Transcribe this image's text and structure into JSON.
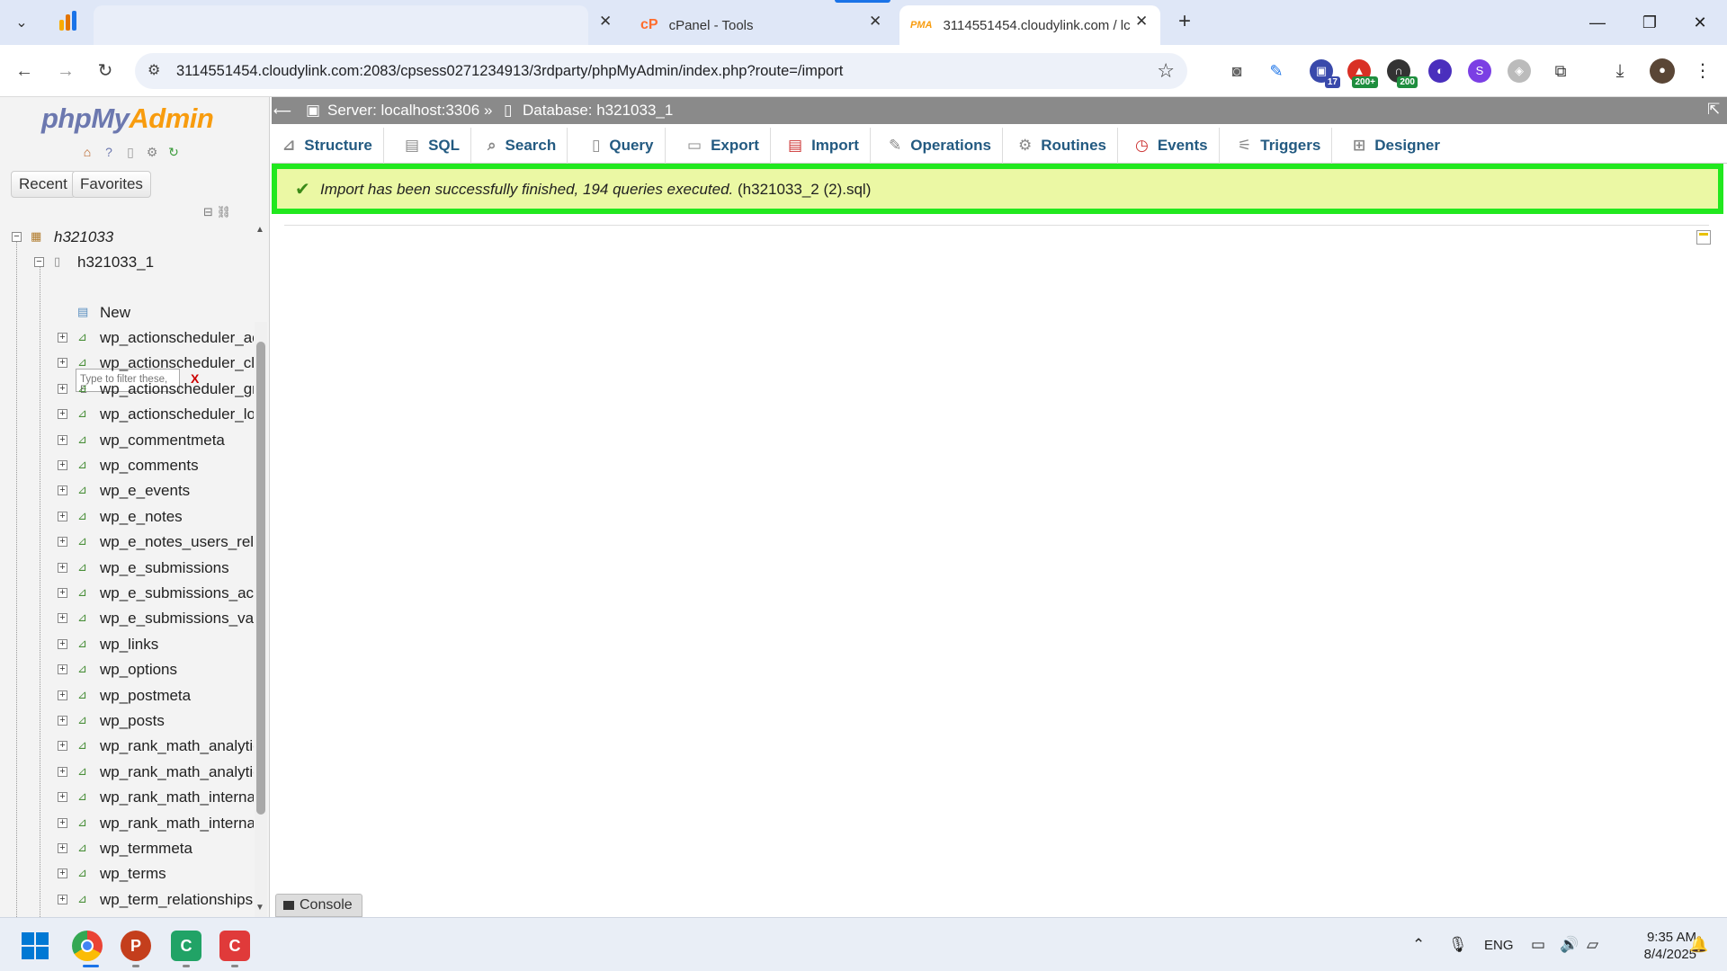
{
  "browser": {
    "tabs": [
      {
        "title": "",
        "active": false
      },
      {
        "title": "cPanel - Tools",
        "active": false
      },
      {
        "title": "3114551454.cloudylink.com / lc",
        "active": true
      }
    ],
    "url": "3114551454.cloudylink.com:2083/cpsess0271234913/3rdparty/phpMyAdmin/index.php?route=/import",
    "extensions": [
      {
        "icon": "camera-icon"
      },
      {
        "icon": "pen-icon"
      },
      {
        "icon": "briefcase-icon",
        "badge": "17"
      },
      {
        "icon": "alert-icon",
        "badge": "200+"
      },
      {
        "icon": "headset-icon",
        "badge": "200"
      },
      {
        "icon": "planet-icon"
      },
      {
        "icon": "shield-s-icon"
      },
      {
        "icon": "shield-icon"
      },
      {
        "icon": "puzzle-icon"
      }
    ]
  },
  "pma": {
    "logo_php": "php",
    "logo_my": "My",
    "logo_admin": "Admin",
    "recent_label": "Recent",
    "favorites_label": "Favorites",
    "server_node": "h321033",
    "db_node": "h321033_1",
    "filter_placeholder": "Type to filter these, E",
    "filter_clear": "X",
    "new_label": "New",
    "tables": [
      "wp_actionscheduler_ac",
      "wp_actionscheduler_cla",
      "wp_actionscheduler_gr",
      "wp_actionscheduler_log",
      "wp_commentmeta",
      "wp_comments",
      "wp_e_events",
      "wp_e_notes",
      "wp_e_notes_users_rela",
      "wp_e_submissions",
      "wp_e_submissions_act",
      "wp_e_submissions_val",
      "wp_links",
      "wp_options",
      "wp_postmeta",
      "wp_posts",
      "wp_rank_math_analytic",
      "wp_rank_math_analytic",
      "wp_rank_math_internal",
      "wp_rank_math_internal",
      "wp_termmeta",
      "wp_terms",
      "wp_term_relationships"
    ],
    "breadcrumb": {
      "server": "Server: localhost:3306",
      "separator": "»",
      "database": "Database: h321033_1"
    },
    "menu_tabs": [
      "Structure",
      "SQL",
      "Search",
      "Query",
      "Export",
      "Import",
      "Operations",
      "Routines",
      "Events",
      "Triggers",
      "Designer"
    ],
    "success_message": "Import has been successfully finished, 194 queries executed.",
    "success_file": "(h321033_2 (2).sql)",
    "console_label": "Console"
  },
  "taskbar": {
    "language": "ENG",
    "time": "9:35 AM",
    "date": "8/4/2025"
  },
  "colors": {
    "success_border": "#21e81e",
    "success_bg": "#ebf8a4",
    "tab_link": "#235a81",
    "breadcrumb_bg": "#8a8a8a"
  }
}
